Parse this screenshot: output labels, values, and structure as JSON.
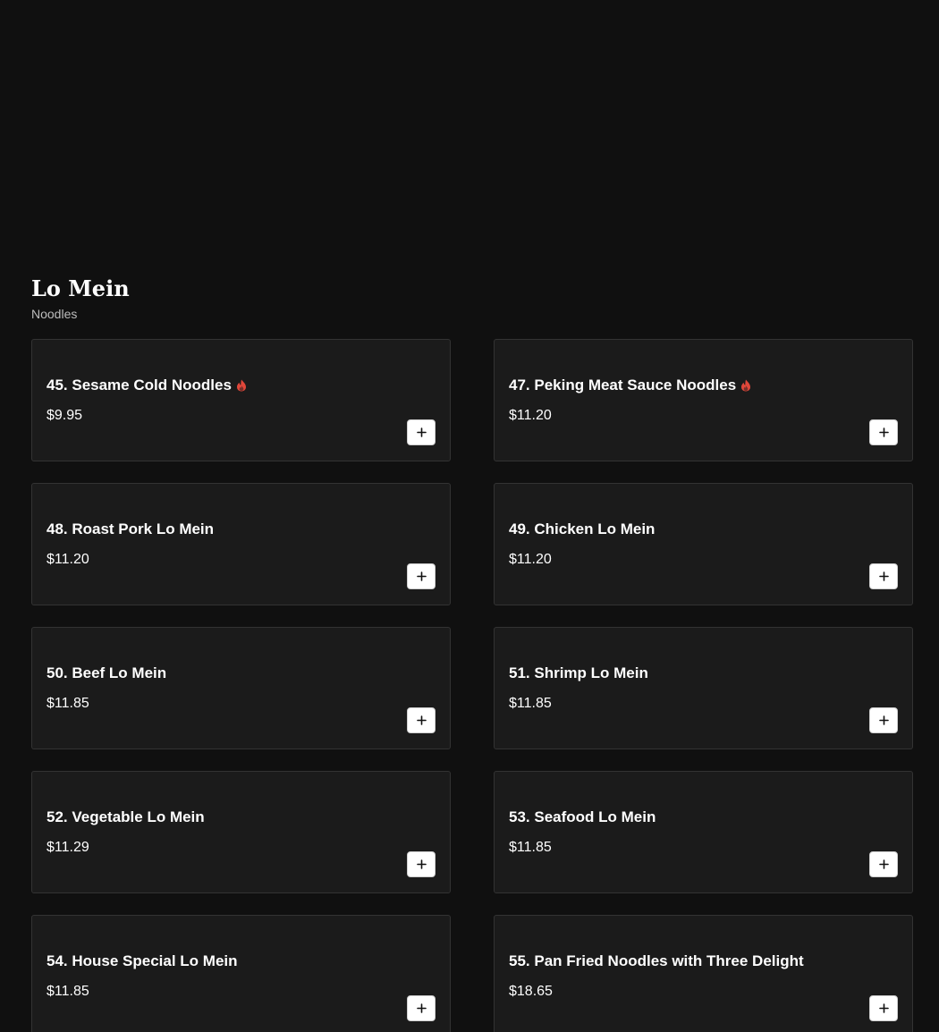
{
  "section": {
    "title": "Lo Mein",
    "subtitle": "Noodles"
  },
  "colors": {
    "background": "#101010",
    "card": "#1b1b1b",
    "card_border": "#333333",
    "spicy": "#e0473a"
  },
  "items": [
    {
      "name": "45. Sesame Cold Noodles",
      "price": "$9.95",
      "spicy": true
    },
    {
      "name": "47. Peking Meat Sauce Noodles",
      "price": "$11.20",
      "spicy": true
    },
    {
      "name": "48. Roast Pork Lo Mein",
      "price": "$11.20",
      "spicy": false
    },
    {
      "name": "49. Chicken Lo Mein",
      "price": "$11.20",
      "spicy": false
    },
    {
      "name": "50. Beef Lo Mein",
      "price": "$11.85",
      "spicy": false
    },
    {
      "name": "51. Shrimp Lo Mein",
      "price": "$11.85",
      "spicy": false
    },
    {
      "name": "52. Vegetable Lo Mein",
      "price": "$11.29",
      "spicy": false
    },
    {
      "name": "53. Seafood Lo Mein",
      "price": "$11.85",
      "spicy": false
    },
    {
      "name": "54. House Special Lo Mein",
      "price": "$11.85",
      "spicy": false
    },
    {
      "name": "55. Pan Fried Noodles with Three Delight",
      "price": "$18.65",
      "spicy": false
    }
  ]
}
